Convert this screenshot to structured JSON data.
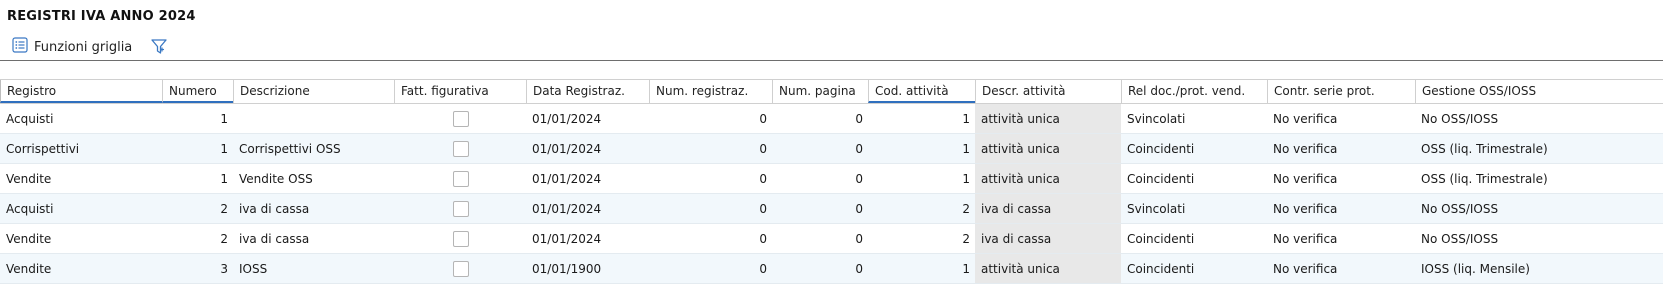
{
  "page": {
    "title": "REGISTRI IVA ANNO 2024"
  },
  "toolbar": {
    "grid_functions_label": "Funzioni griglia"
  },
  "grid": {
    "columns": [
      "Registro",
      "Numero",
      "Descrizione",
      "Fatt. figurativa",
      "Data Registraz.",
      "Num. registraz.",
      "Num. pagina",
      "Cod. attività",
      "Descr. attività",
      "Rel doc./prot. vend.",
      "Contr. serie prot.",
      "Gestione OSS/IOSS"
    ],
    "rows": [
      {
        "registro": "Acquisti",
        "numero": "1",
        "descrizione": "",
        "fatt_figurativa": false,
        "data": "01/01/2024",
        "num_registraz": "0",
        "num_pagina": "0",
        "cod_attivita": "1",
        "descr_attivita": "attività unica",
        "rel_doc": "Svincolati",
        "contr_serie": "No verifica",
        "gestione": "No OSS/IOSS"
      },
      {
        "registro": "Corrispettivi",
        "numero": "1",
        "descrizione": "Corrispettivi OSS",
        "fatt_figurativa": false,
        "data": "01/01/2024",
        "num_registraz": "0",
        "num_pagina": "0",
        "cod_attivita": "1",
        "descr_attivita": "attività unica",
        "rel_doc": "Coincidenti",
        "contr_serie": "No verifica",
        "gestione": "OSS (liq. Trimestrale)"
      },
      {
        "registro": "Vendite",
        "numero": "1",
        "descrizione": "Vendite OSS",
        "fatt_figurativa": false,
        "data": "01/01/2024",
        "num_registraz": "0",
        "num_pagina": "0",
        "cod_attivita": "1",
        "descr_attivita": "attività unica",
        "rel_doc": "Coincidenti",
        "contr_serie": "No verifica",
        "gestione": "OSS (liq. Trimestrale)"
      },
      {
        "registro": "Acquisti",
        "numero": "2",
        "descrizione": "iva di cassa",
        "fatt_figurativa": false,
        "data": "01/01/2024",
        "num_registraz": "0",
        "num_pagina": "0",
        "cod_attivita": "2",
        "descr_attivita": "iva di cassa",
        "rel_doc": "Svincolati",
        "contr_serie": "No verifica",
        "gestione": "No OSS/IOSS"
      },
      {
        "registro": "Vendite",
        "numero": "2",
        "descrizione": "iva di cassa",
        "fatt_figurativa": false,
        "data": "01/01/2024",
        "num_registraz": "0",
        "num_pagina": "0",
        "cod_attivita": "2",
        "descr_attivita": "iva di cassa",
        "rel_doc": "Coincidenti",
        "contr_serie": "No verifica",
        "gestione": "No OSS/IOSS"
      },
      {
        "registro": "Vendite",
        "numero": "3",
        "descrizione": "IOSS",
        "fatt_figurativa": false,
        "data": "01/01/1900",
        "num_registraz": "0",
        "num_pagina": "0",
        "cod_attivita": "1",
        "descr_attivita": "attività unica",
        "rel_doc": "Coincidenti",
        "contr_serie": "No verifica",
        "gestione": "IOSS (liq. Mensile)"
      }
    ]
  }
}
